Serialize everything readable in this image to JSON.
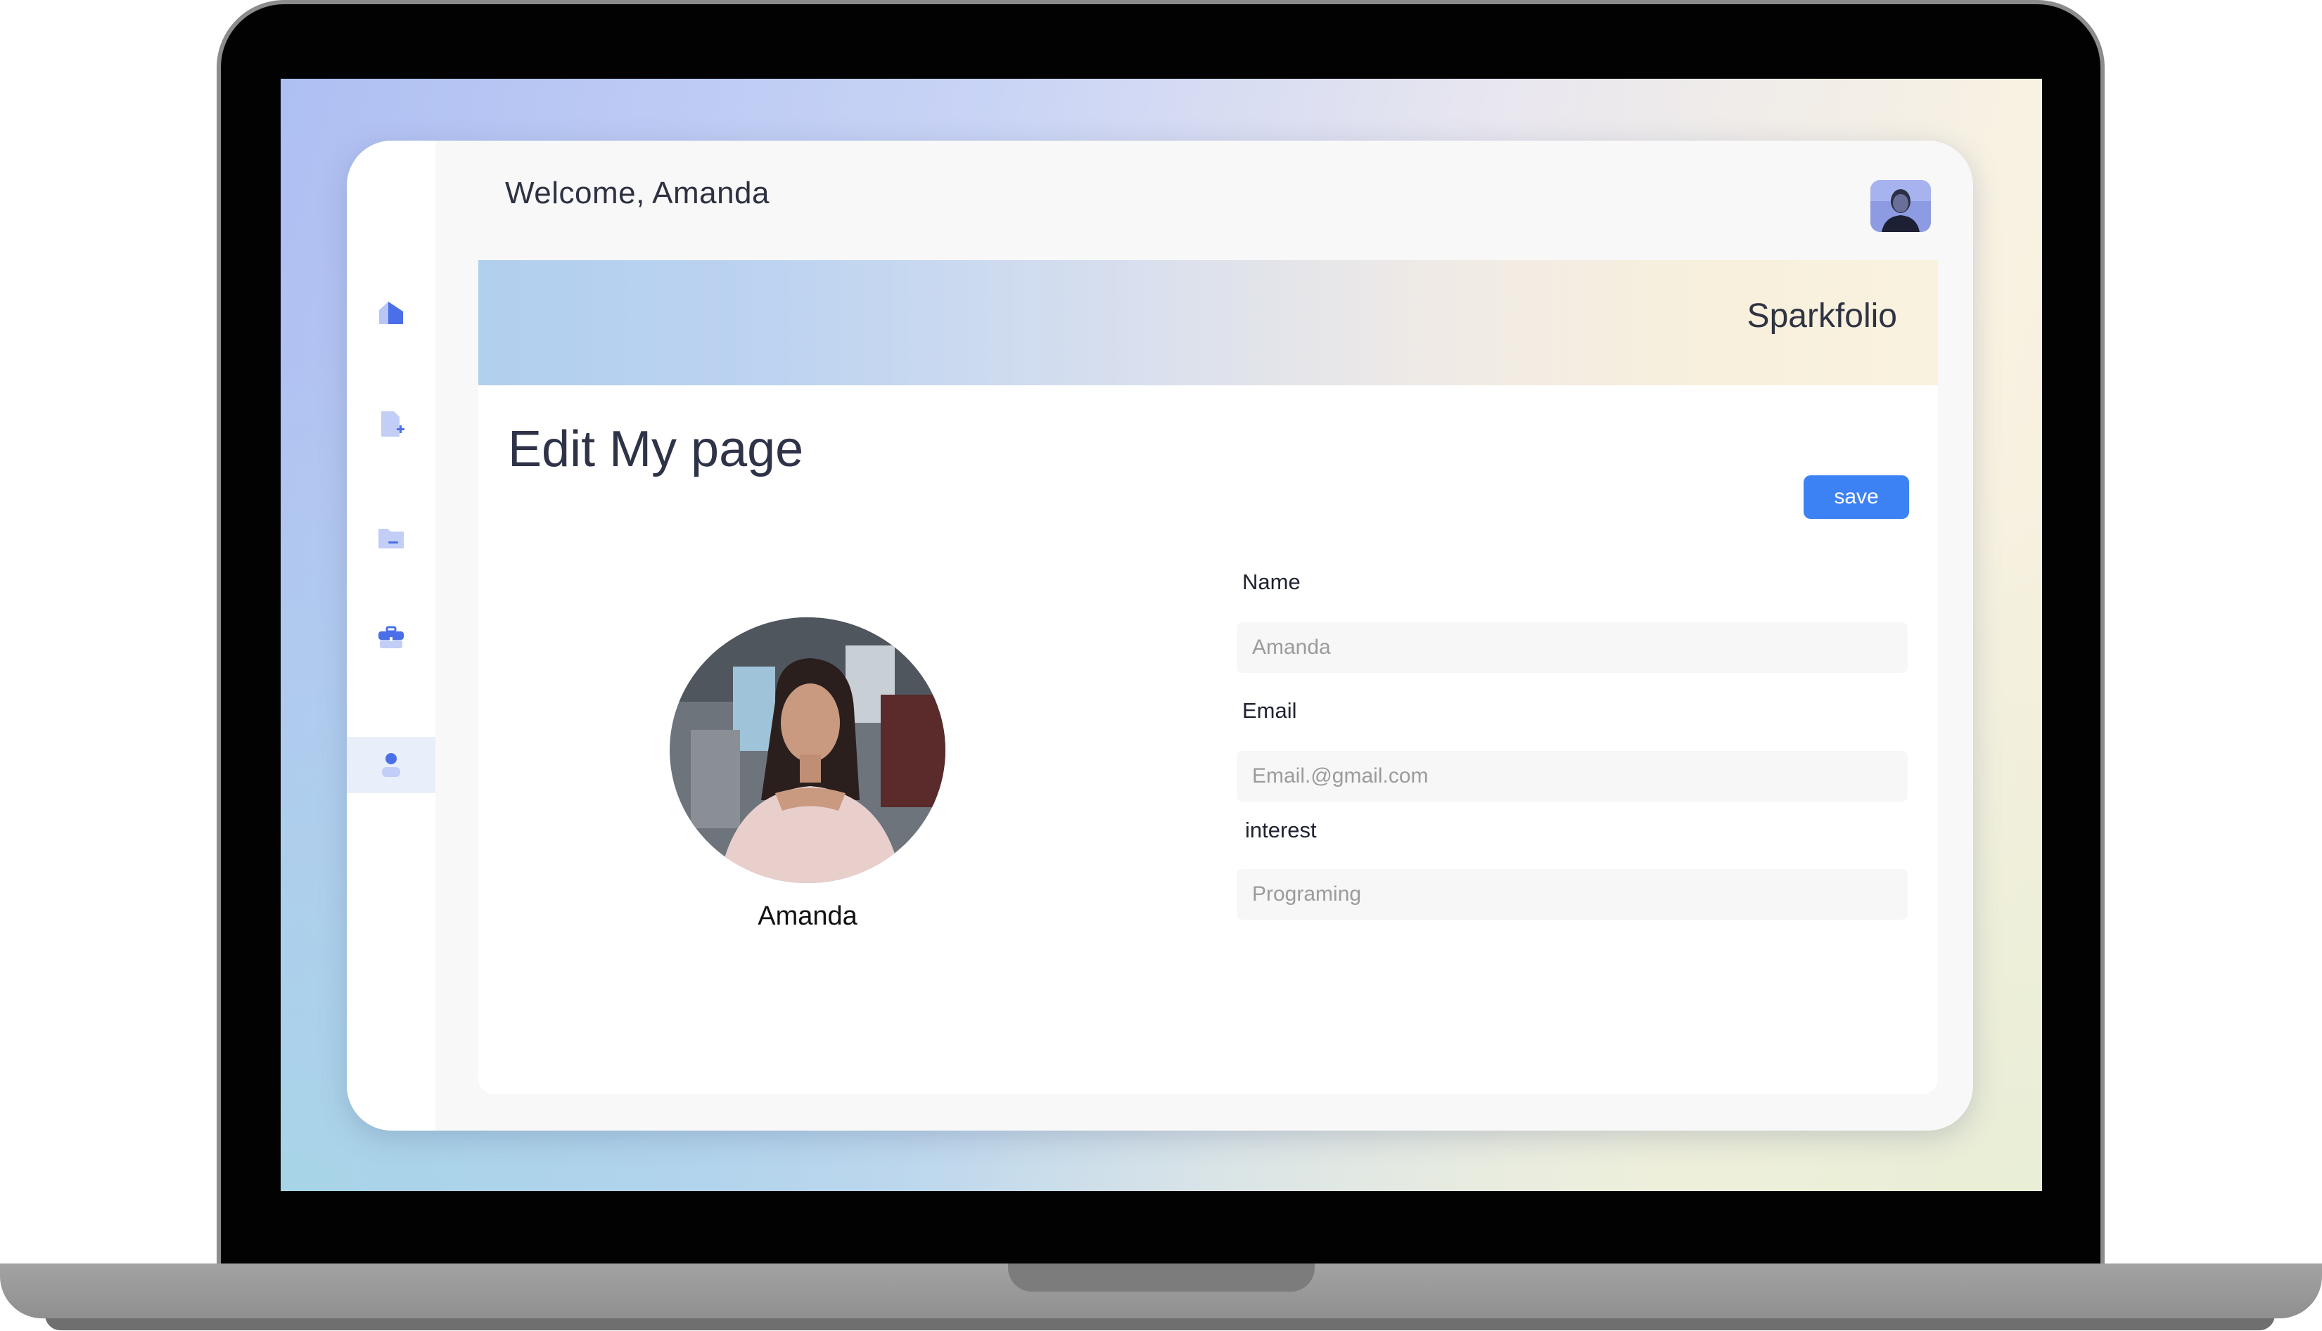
{
  "header": {
    "welcome": "Welcome, Amanda"
  },
  "banner": {
    "brand": "Sparkfolio"
  },
  "sidebar": {
    "items": [
      {
        "icon": "home-icon"
      },
      {
        "icon": "new-document-icon"
      },
      {
        "icon": "folder-icon"
      },
      {
        "icon": "briefcase-icon"
      },
      {
        "icon": "user-icon",
        "active": true
      }
    ]
  },
  "main": {
    "title": "Edit My page",
    "save_label": "save",
    "profile_name": "Amanda",
    "fields": {
      "name": {
        "label": "Name",
        "placeholder": "Amanda"
      },
      "email": {
        "label": "Email",
        "placeholder": "Email.@gmail.com"
      },
      "interest": {
        "label": "interest",
        "placeholder": "Programing"
      }
    }
  },
  "colors": {
    "accent": "#3d82f4",
    "icon": "#4a6fe8",
    "text": "#2e3348"
  }
}
